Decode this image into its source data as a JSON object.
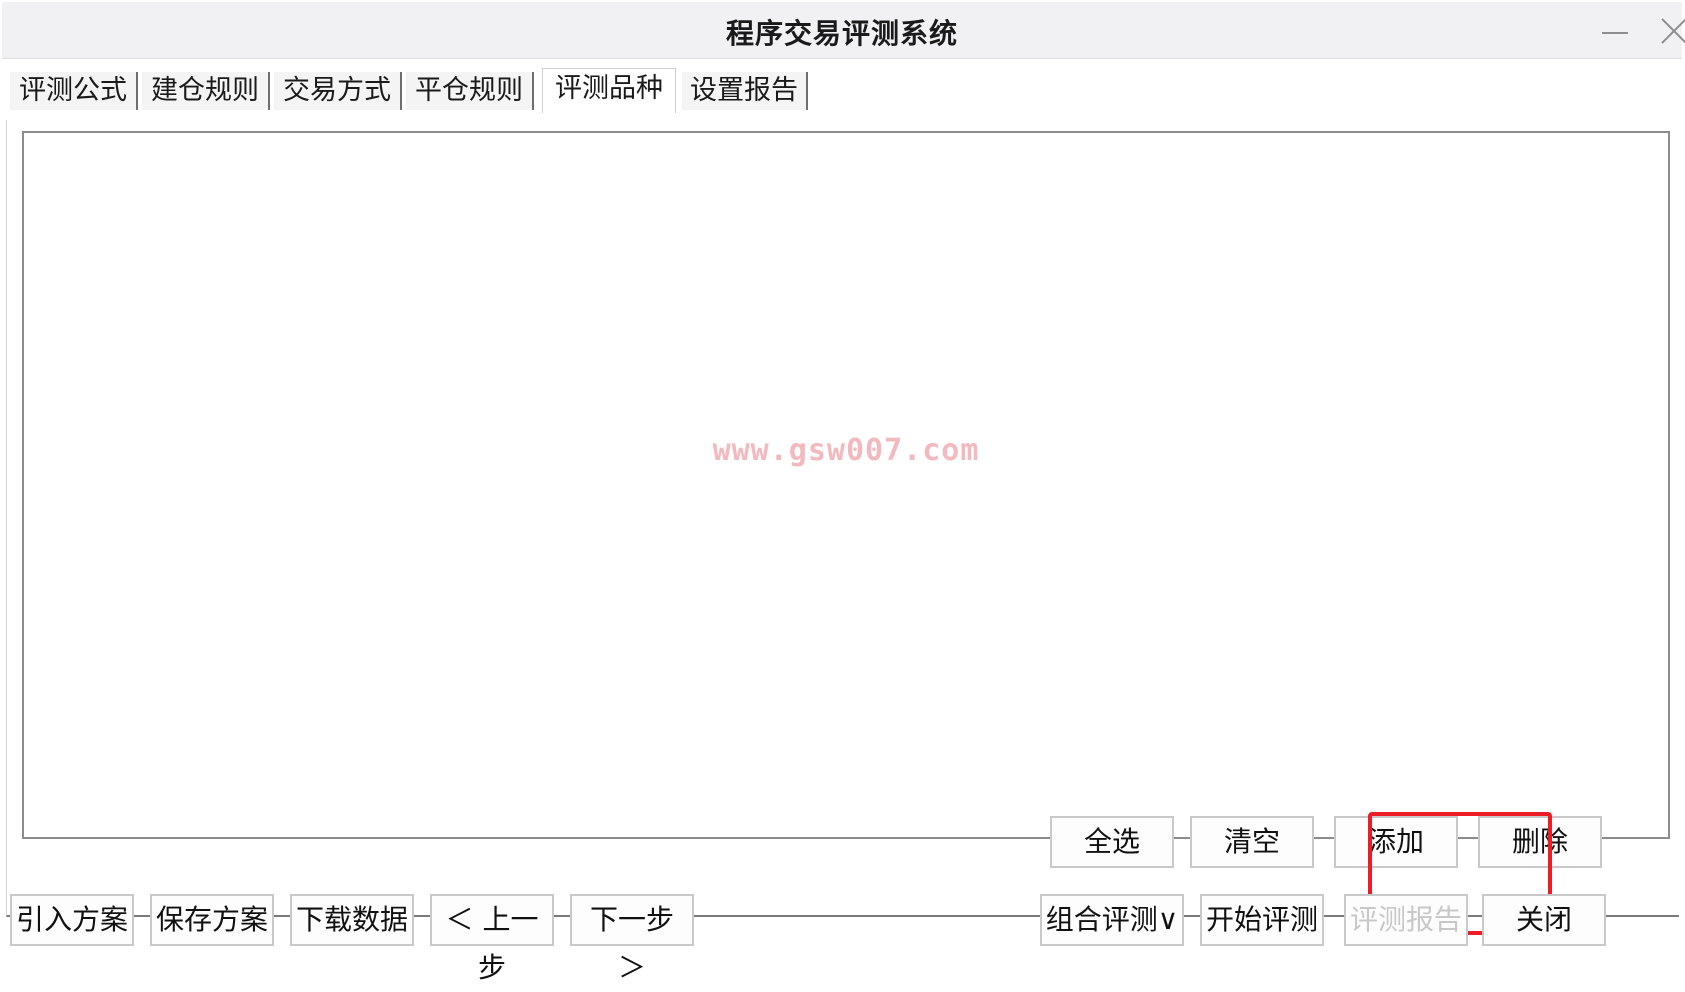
{
  "window": {
    "title": "程序交易评测系统"
  },
  "tabs": [
    {
      "label": "评测公式"
    },
    {
      "label": "建仓规则"
    },
    {
      "label": "交易方式"
    },
    {
      "label": "平仓规则"
    },
    {
      "label": "评测品种"
    },
    {
      "label": "设置报告"
    }
  ],
  "active_tab": "评测品种",
  "list": {
    "watermark": "www.gsw007.com"
  },
  "panel_buttons": {
    "select_all": "全选",
    "clear": "清空",
    "add": "添加",
    "delete": "删除"
  },
  "footer_buttons": {
    "import_plan": "引入方案",
    "save_plan": "保存方案",
    "download_data": "下载数据",
    "prev_step": "＜ 上一步",
    "next_step": "下一步 ＞",
    "combo_test": "组合评测∨",
    "start_test": "开始评测",
    "test_report": "评测报告",
    "close": "关闭"
  },
  "colors": {
    "highlight": "#ee1c24",
    "watermark": "#f3b9be",
    "disabled_text": "#c8c8c8"
  }
}
